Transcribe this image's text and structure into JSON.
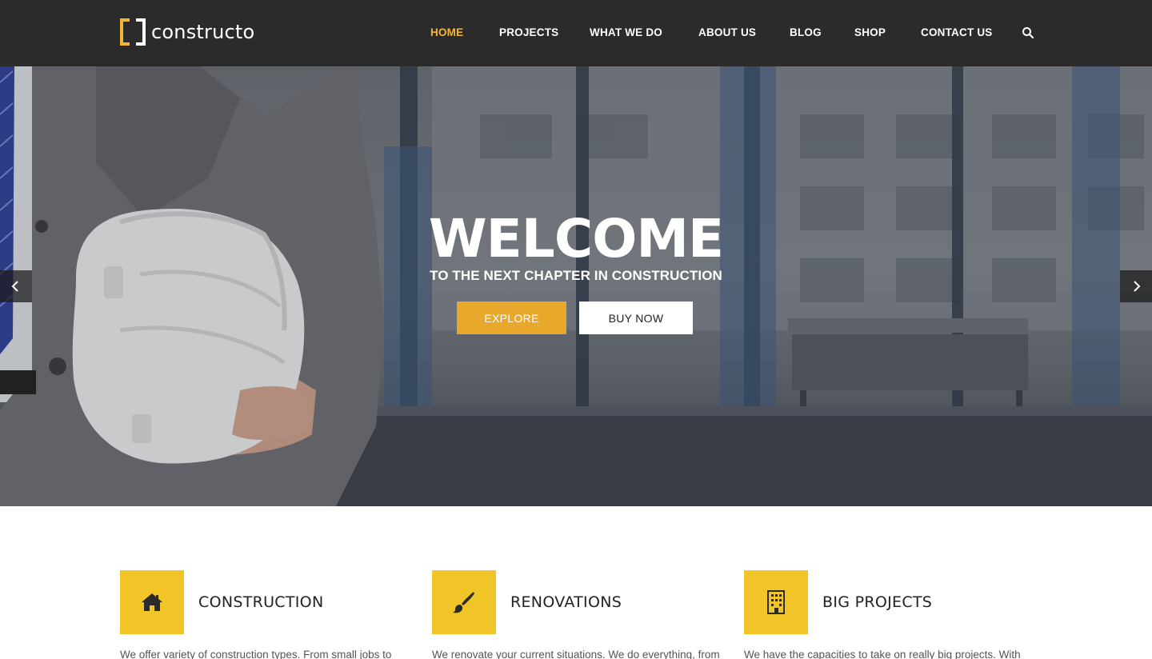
{
  "brand": {
    "name": "constructo",
    "accent": "#f2b632"
  },
  "nav": {
    "items": [
      {
        "label": "HOME",
        "active": true
      },
      {
        "label": "PROJECTS",
        "active": false
      },
      {
        "label": "WHAT WE DO",
        "active": false
      },
      {
        "label": "ABOUT US",
        "active": false
      },
      {
        "label": "BLOG",
        "active": false
      },
      {
        "label": "SHOP",
        "active": false
      },
      {
        "label": "CONTACT US",
        "active": false
      }
    ],
    "search_icon": "search-icon"
  },
  "hero": {
    "title": "WELCOME",
    "subtitle": "TO THE NEXT CHAPTER IN CONSTRUCTION",
    "explore_label": "EXPLORE",
    "buy_label": "BUY NOW",
    "prev_icon": "chevron-left-icon",
    "next_icon": "chevron-right-icon"
  },
  "features": [
    {
      "icon": "home-icon",
      "title": "CONSTRUCTION",
      "text": "We offer variety of construction types. From small jobs to"
    },
    {
      "icon": "paintbrush-icon",
      "title": "RENOVATIONS",
      "text": "We renovate your current situations. We do everything, from"
    },
    {
      "icon": "building-icon",
      "title": "BIG PROJECTS",
      "text": "We have the capacities to take on really big projects. With"
    }
  ],
  "colors": {
    "header_bg": "#2b2b2b",
    "feature_yellow": "#f1c527",
    "explore_btn": "#e8a82c"
  }
}
